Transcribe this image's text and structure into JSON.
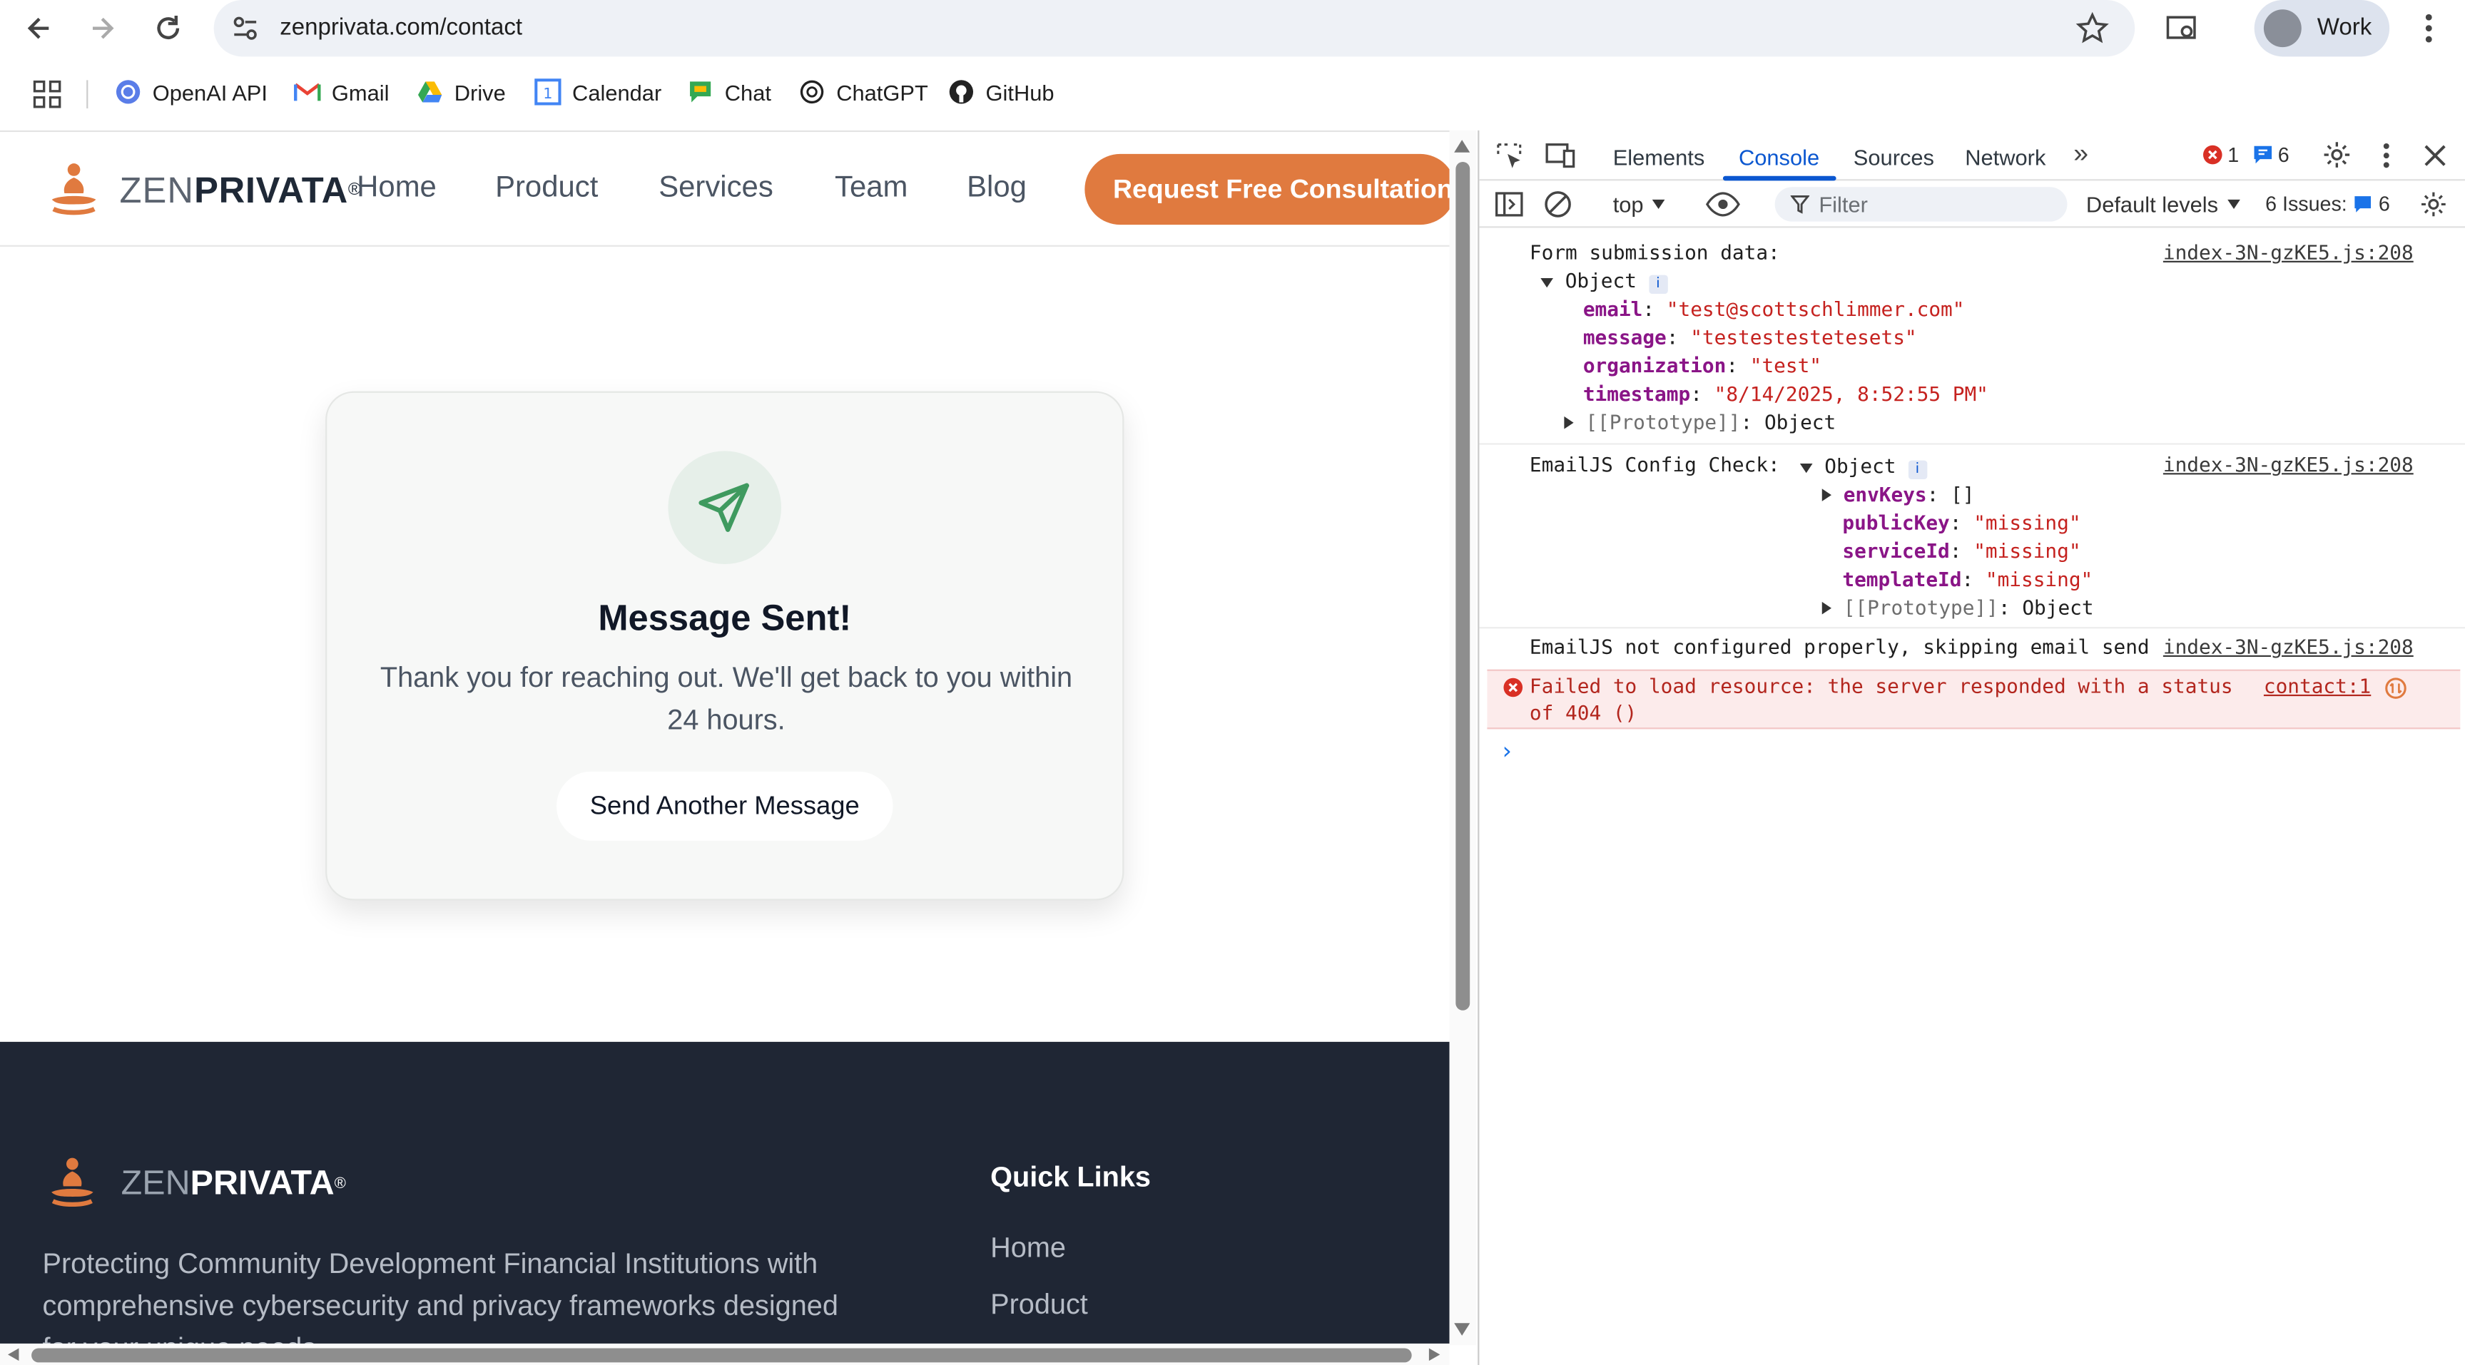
{
  "browser": {
    "url": "zenprivata.com/contact",
    "profile_label": "Work",
    "bookmarks": [
      {
        "label": "OpenAI API",
        "icon": "openai-icon"
      },
      {
        "label": "Gmail",
        "icon": "gmail-icon"
      },
      {
        "label": "Drive",
        "icon": "drive-icon"
      },
      {
        "label": "Calendar",
        "icon": "calendar-icon"
      },
      {
        "label": "Chat",
        "icon": "chat-icon"
      },
      {
        "label": "ChatGPT",
        "icon": "chatgpt-icon"
      },
      {
        "label": "GitHub",
        "icon": "github-icon"
      }
    ]
  },
  "site": {
    "logo": {
      "zen": "ZEN",
      "privata": "PRIVATA",
      "reg": "®"
    },
    "nav": [
      "Home",
      "Product",
      "Services",
      "Team",
      "Blog"
    ],
    "cta": "Request Free Consultation",
    "colors": {
      "accent": "#e07a3f",
      "footer_bg": "#1f2634",
      "success_icon": "#3f9a5f"
    }
  },
  "confirmation": {
    "icon": "send-icon",
    "title": "Message Sent!",
    "body": "Thank you for reaching out. We'll get back to you within 24 hours.",
    "button": "Send Another Message"
  },
  "footer": {
    "logo": {
      "zen": "ZEN",
      "privata": "PRIVATA",
      "reg": "®"
    },
    "description": "Protecting Community Development Financial Institutions with comprehensive cybersecurity and privacy frameworks designed for your unique needs.",
    "quick_links_title": "Quick Links",
    "quick_links": [
      "Home",
      "Product"
    ]
  },
  "devtools": {
    "tabs": [
      "Elements",
      "Console",
      "Sources",
      "Network"
    ],
    "active_tab": "Console",
    "error_count": "1",
    "message_count": "6",
    "context": "top",
    "filter_placeholder": "Filter",
    "levels": "Default levels",
    "issues_label": "6 Issues:",
    "issues_count": "6",
    "console": {
      "entry1": {
        "label": "Form submission data:",
        "object": "Object",
        "fields": [
          {
            "key": "email",
            "value": "\"test@scottschlimmer.com\""
          },
          {
            "key": "message",
            "value": "\"testestestetesets\""
          },
          {
            "key": "organization",
            "value": "\"test\""
          },
          {
            "key": "timestamp",
            "value": "\"8/14/2025, 8:52:55 PM\""
          }
        ],
        "prototype": "[[Prototype]]",
        "prototype_value": "Object",
        "source": "index-3N-gzKE5.js:208"
      },
      "entry2": {
        "label": "EmailJS Config Check:",
        "object": "Object",
        "env_key": "envKeys",
        "env_value": "[]",
        "fields": [
          {
            "key": "publicKey",
            "value": "\"missing\""
          },
          {
            "key": "serviceId",
            "value": "\"missing\""
          },
          {
            "key": "templateId",
            "value": "\"missing\""
          }
        ],
        "prototype": "[[Prototype]]",
        "prototype_value": "Object",
        "source": "index-3N-gzKE5.js:208"
      },
      "entry3": {
        "label": "EmailJS not configured properly, skipping email send",
        "source": "index-3N-gzKE5.js:208"
      },
      "error": {
        "line1": "Failed to load resource: the server responded with a status",
        "line2": "of 404 ()",
        "source": "contact:1"
      }
    }
  }
}
